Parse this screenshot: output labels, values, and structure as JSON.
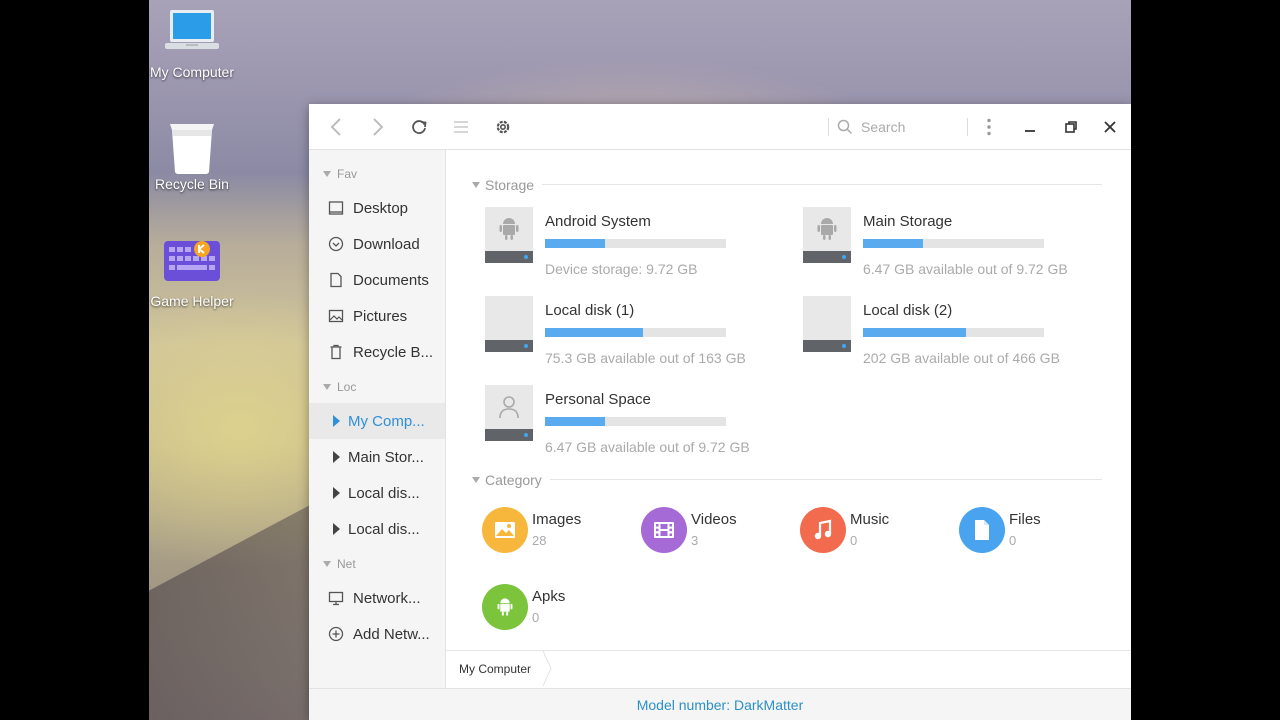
{
  "desktop": {
    "icons": [
      {
        "label": "My Computer",
        "icon": "laptop-icon"
      },
      {
        "label": "Recycle Bin",
        "icon": "recycle-bin-icon"
      },
      {
        "label": "Game Helper",
        "icon": "keyboard-icon"
      }
    ]
  },
  "toolbar": {
    "search_placeholder": "Search",
    "icons": [
      "back-icon",
      "forward-icon",
      "refresh-icon",
      "list-view-icon",
      "settings-icon",
      "more-icon",
      "minimize-icon",
      "maximize-icon",
      "close-icon"
    ]
  },
  "sidebar": {
    "sections": [
      {
        "label": "Fav"
      },
      {
        "label": "Loc"
      },
      {
        "label": "Net"
      }
    ],
    "fav": [
      {
        "label": "Desktop",
        "icon": "desktop-icon"
      },
      {
        "label": "Download",
        "icon": "download-icon"
      },
      {
        "label": "Documents",
        "icon": "document-icon"
      },
      {
        "label": "Pictures",
        "icon": "picture-icon"
      },
      {
        "label": "Recycle B...",
        "icon": "trash-icon"
      }
    ],
    "loc": [
      {
        "label": "My Comp...",
        "active": true
      },
      {
        "label": "Main Stor..."
      },
      {
        "label": "Local dis..."
      },
      {
        "label": "Local dis..."
      }
    ],
    "net": [
      {
        "label": "Network...",
        "icon": "network-icon"
      },
      {
        "label": "Add Netw...",
        "icon": "add-icon"
      }
    ]
  },
  "content": {
    "storage_heading": "Storage",
    "drives": [
      {
        "name": "Android System",
        "info": "Device storage: 9.72 GB",
        "used_fraction": 0.33,
        "glyph": "android-icon"
      },
      {
        "name": "Main Storage",
        "info": "6.47 GB available out of 9.72 GB",
        "used_fraction": 0.33,
        "glyph": "android-icon"
      },
      {
        "name": "Local disk (1)",
        "info": "75.3 GB available out of 163 GB",
        "used_fraction": 0.54,
        "glyph": "none"
      },
      {
        "name": "Local disk (2)",
        "info": "202 GB available out of 466 GB",
        "used_fraction": 0.57,
        "glyph": "none"
      },
      {
        "name": "Personal Space",
        "info": "6.47 GB available out of 9.72 GB",
        "used_fraction": 0.33,
        "glyph": "person-icon"
      }
    ],
    "category_heading": "Category",
    "categories": [
      {
        "name": "Images",
        "count": "28",
        "color": "#f6b73c",
        "icon": "image-icon"
      },
      {
        "name": "Videos",
        "count": "3",
        "color": "#a56ad6",
        "icon": "video-icon"
      },
      {
        "name": "Music",
        "count": "0",
        "color": "#f26b4e",
        "icon": "music-icon"
      },
      {
        "name": "Files",
        "count": "0",
        "color": "#4aa3ef",
        "icon": "file-icon"
      },
      {
        "name": "Apks",
        "count": "0",
        "color": "#7cc43b",
        "icon": "android-icon"
      }
    ]
  },
  "pathbar": {
    "crumb": "My Computer"
  },
  "statusbar": {
    "text": "Model number: DarkMatter"
  }
}
